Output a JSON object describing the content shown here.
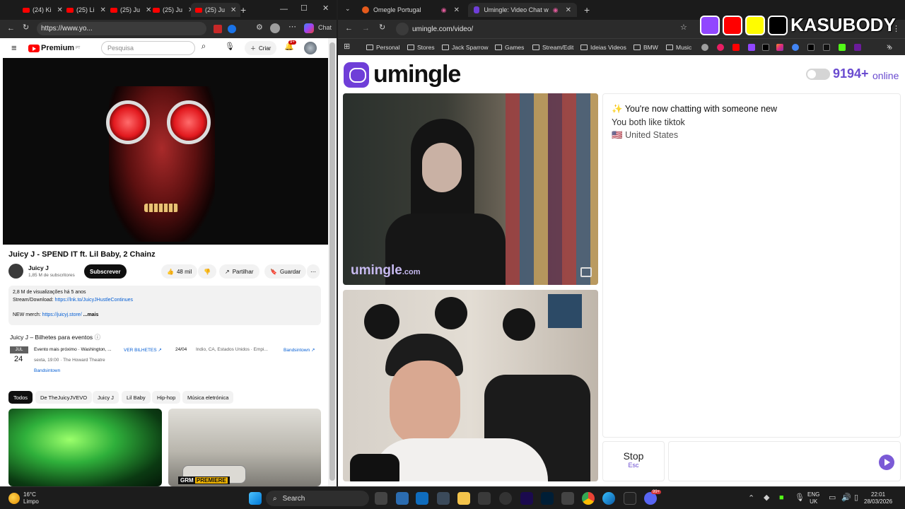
{
  "left_browser": {
    "tabs": [
      {
        "label": "(24) Ki"
      },
      {
        "label": "(25) Li"
      },
      {
        "label": "(25) Ju"
      },
      {
        "label": "(25) Ju"
      },
      {
        "label": "(25) Ju"
      }
    ],
    "url": "https://www.yo...",
    "chat_label": "Chat",
    "youtube": {
      "logo": "Premium",
      "region": "PT",
      "search_placeholder": "Pesquisa",
      "create_label": "Criar",
      "notif_count": "9+",
      "video_title": "Juicy J - SPEND IT ft. Lil Baby, 2 Chainz",
      "channel_name": "Juicy J",
      "subscribers": "1,85 M de subscritores",
      "subscribe_label": "Subscrever",
      "likes": "48 mil",
      "share_label": "Partilhar",
      "save_label": "Guardar",
      "description": {
        "views": "2,8 M de visualizações",
        "age": "há 5 anos",
        "stream_label": "Stream/Download:",
        "stream_link": "https://lnk.to/JuicyJHustleContinues",
        "merch_label": "NEW merch:",
        "merch_link": "https://juicyj.store/",
        "more": "...mais"
      },
      "events": {
        "heading": "Juicy J – Bilhetes para eventos",
        "month": "JUL",
        "day": "24",
        "next_event": "Evento mais próximo · Washington, ...",
        "time": "sexta, 19:00 · The Howard Theatre",
        "source": "Bandsintown",
        "tickets_label": "VER BILHETES",
        "date2": "24/04",
        "venue2": "Indio, CA, Estados Unidos · Empi...",
        "source2": "Bandsintown"
      },
      "chips": [
        "Todos",
        "De TheJuicyJVEVO",
        "Juicy J",
        "Lil Baby",
        "Hip-hop",
        "Música eletrónica"
      ],
      "thumb2_label": "PREMIERE",
      "thumb2_brand": "GRM"
    }
  },
  "right_browser": {
    "tabs": [
      {
        "label": "Omegle Portugal"
      },
      {
        "label": "Umingle: Video Chat with S"
      }
    ],
    "url": "umingle.com/video/",
    "bookmarks": [
      "Personal",
      "Stores",
      "Jack Sparrow",
      "Games",
      "Stream/Edit",
      "Ideias Videos",
      "BMW",
      "Music"
    ],
    "umingle": {
      "logo": "umingle",
      "online_count": "9194+",
      "online_label": "online",
      "watermark": "umingle",
      "watermark_suffix": ".com",
      "chat_line1": "You're now chatting with someone new",
      "chat_line2": "You both like tiktok",
      "chat_line3": "United States",
      "stop_label": "Stop",
      "stop_hint": "Esc"
    }
  },
  "overlay": {
    "channel": "KASUBODY"
  },
  "taskbar": {
    "weather_temp": "16°C",
    "weather_desc": "Limpo",
    "search_label": "Search",
    "lang1": "ENG",
    "lang2": "UK",
    "time": "22:01",
    "date": "28/03/2026",
    "badge": "99+"
  },
  "colors": {
    "youtube_red": "#ff0000",
    "umingle_purple": "#6f3ed8",
    "online_purple": "#6a4bd0",
    "link_blue": "#065fd4"
  }
}
